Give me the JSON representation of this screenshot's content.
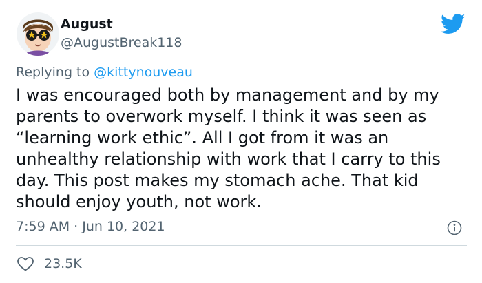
{
  "author": {
    "display_name": "August",
    "handle": "@AugustBreak118"
  },
  "reply": {
    "prefix": "Replying to",
    "mention": "@kittynouveau"
  },
  "tweet": {
    "text": "I was encouraged both by management and by my\nparents to overwork myself. I think it was seen as\n“learning work ethic”. All I got from it was an\nunhealthy relationship with work that I carry to this\nday. This post makes my stomach ache. That kid\nshould enjoy youth, not work.",
    "timestamp": "7:59 AM · Jun 10, 2021"
  },
  "stats": {
    "likes": "23.5K"
  },
  "icons": {
    "brand": "twitter-bird-icon",
    "info": "info-icon",
    "like": "heart-icon"
  },
  "colors": {
    "brand": "#1d9bf0",
    "text": "#0f1419",
    "secondary": "#536471"
  }
}
